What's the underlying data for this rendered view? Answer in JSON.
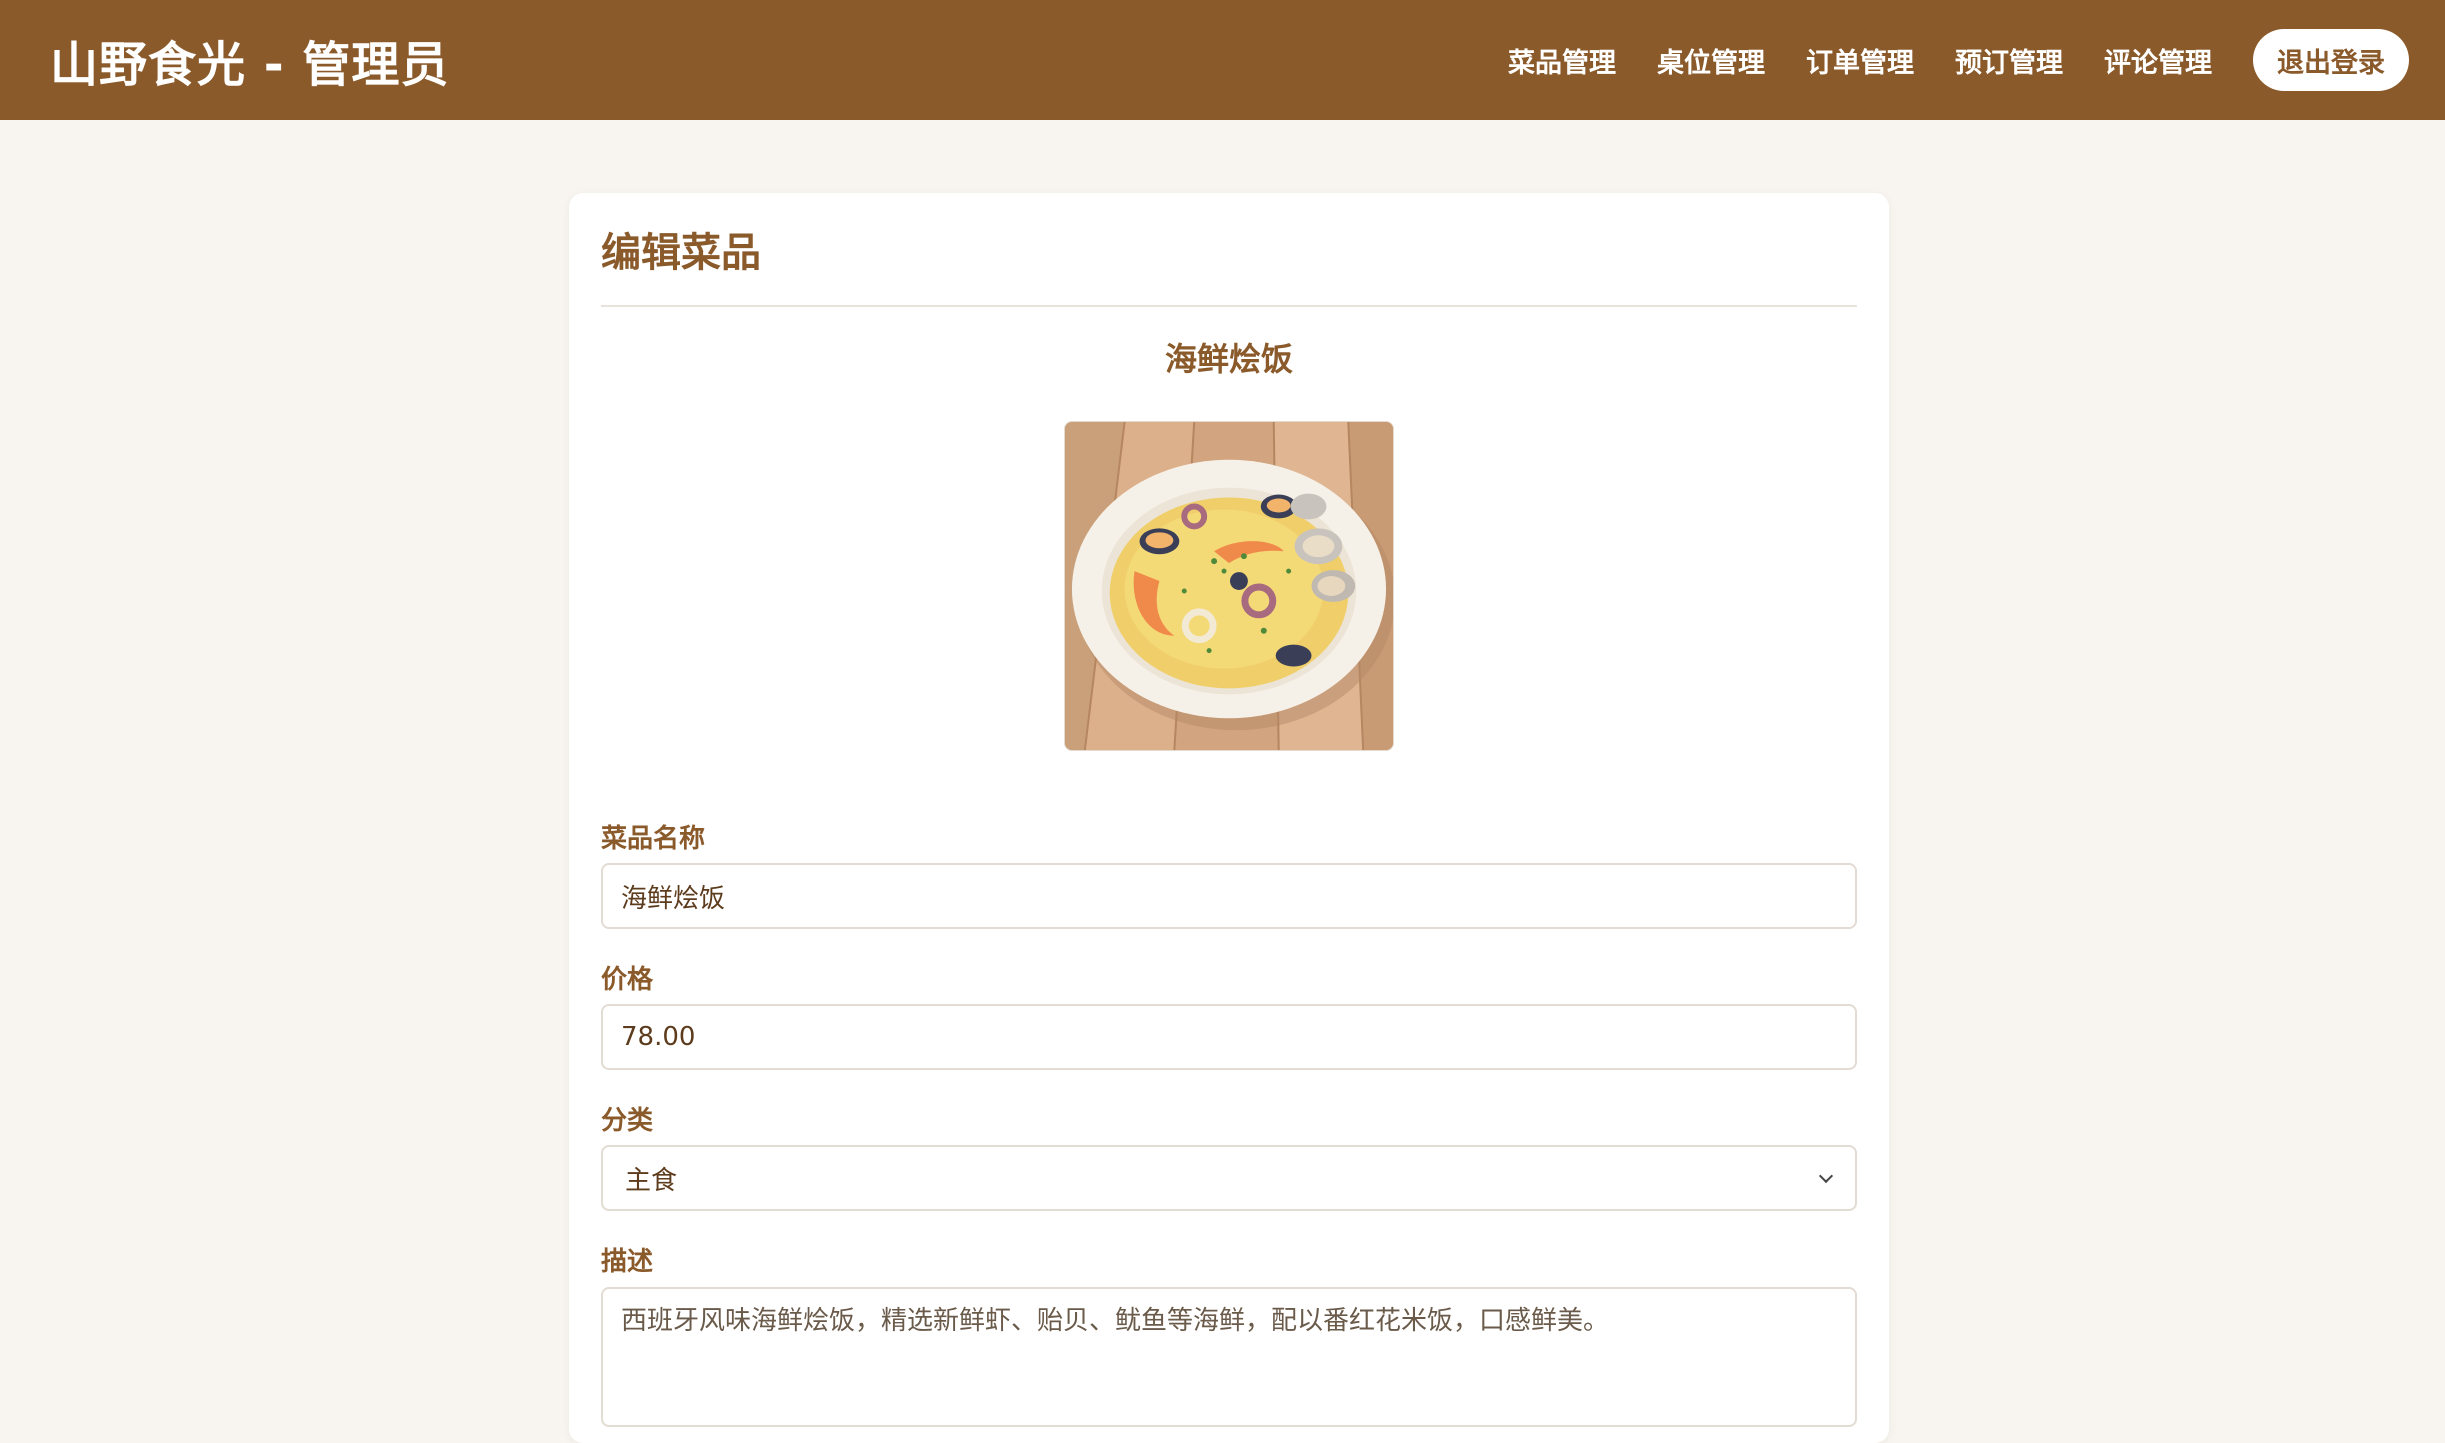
{
  "header": {
    "title": "山野食光 - 管理员",
    "nav": [
      {
        "label": "菜品管理"
      },
      {
        "label": "桌位管理"
      },
      {
        "label": "订单管理"
      },
      {
        "label": "预订管理"
      },
      {
        "label": "评论管理"
      }
    ],
    "logout_label": "退出登录"
  },
  "main": {
    "title": "编辑菜品",
    "dish_name_display": "海鲜烩饭",
    "image_icon": "dish-photo-seafood-rice",
    "fields": {
      "name": {
        "label": "菜品名称",
        "value": "海鲜烩饭"
      },
      "price": {
        "label": "价格",
        "value": "78.00"
      },
      "category": {
        "label": "分类",
        "value": "主食"
      },
      "description": {
        "label": "描述",
        "value": "西班牙风味海鲜烩饭，精选新鲜虾、贻贝、鱿鱼等海鲜，配以番红花米饭，口感鲜美。"
      }
    }
  },
  "colors": {
    "header_bg": "#8b5a2b",
    "accent": "#8b5a2b",
    "page_bg": "#f8f5f0"
  }
}
